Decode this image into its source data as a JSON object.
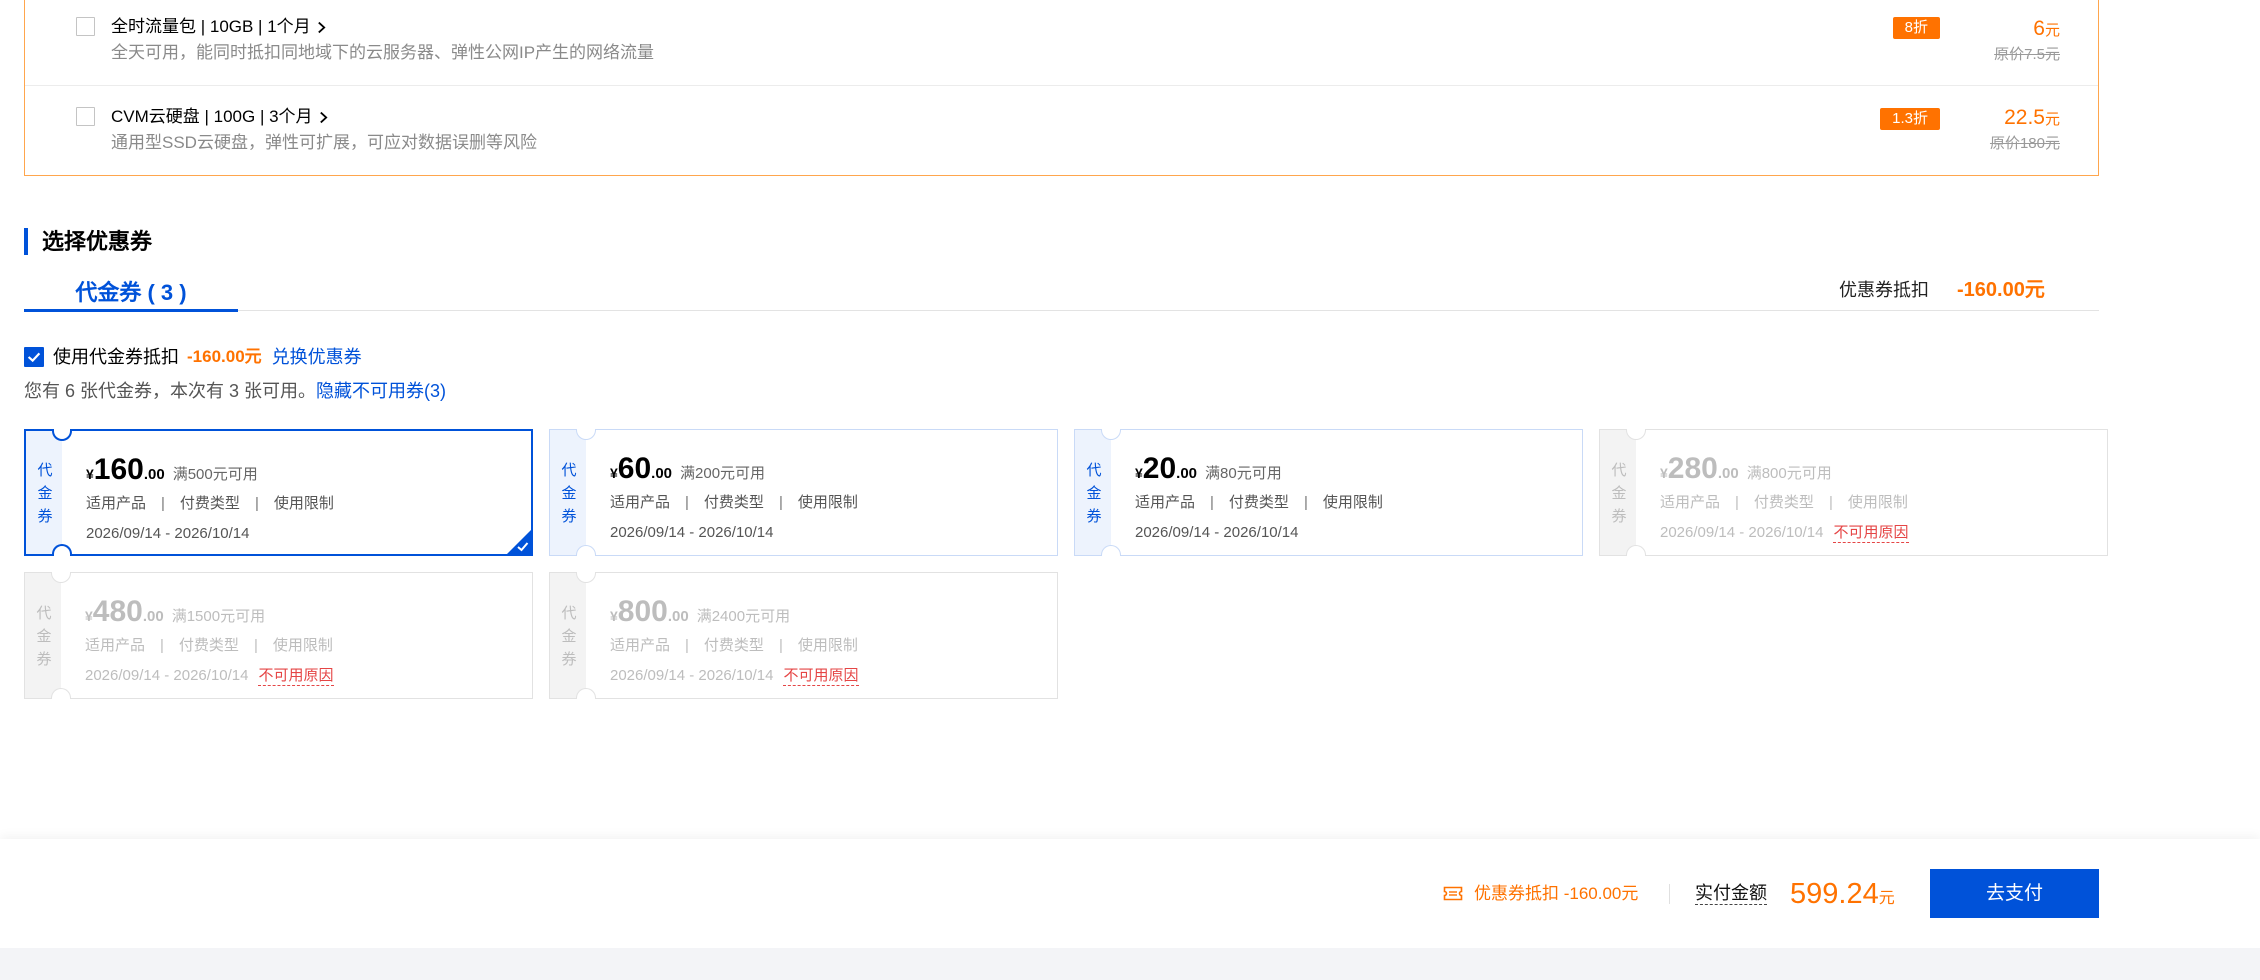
{
  "colors": {
    "accent_blue": "#0052d9",
    "price_orange": "#ff7200",
    "addon_border": "#ffa64d",
    "unavailable_red": "#e54545"
  },
  "icons": {
    "addon_title": "chevron-right-icon",
    "checkbox_checked": "check-icon",
    "footer_coupon": "ticket-icon",
    "selected_coupon": "corner-check-icon"
  },
  "addons": [
    {
      "title": "全时流量包 | 10GB | 1个月",
      "description": "全天可用，能同时抵扣同地域下的云服务器、弹性公网IP产生的网络流量",
      "discount": "8折",
      "price": "6",
      "price_unit": "元",
      "original_price": "原价7.5元",
      "checked": false
    },
    {
      "title": "CVM云硬盘 | 100G | 3个月",
      "description": "通用型SSD云硬盘，弹性可扩展，可应对数据误删等风险",
      "discount": "1.3折",
      "price": "22.5",
      "price_unit": "元",
      "original_price": "原价180元",
      "checked": false
    }
  ],
  "coupon_section": {
    "title": "选择优惠券",
    "tab_label": "代金券 ( 3 )",
    "deduct_label": "优惠券抵扣",
    "deduct_value": "-160.00元",
    "use_coupon_checked": true,
    "use_coupon_label": "使用代金券抵扣",
    "use_coupon_value": "-160.00元",
    "exchange_link": "兑换优惠券",
    "summary_text": "您有 6 张代金券，本次有 3 张可用。",
    "hide_unavailable_link": "隐藏不可用券(3)"
  },
  "tag_separator": "|",
  "coupons": [
    {
      "type_label": "代金券",
      "currency": "¥",
      "amount_int": "160",
      "amount_decimal": ".00",
      "threshold": "满500元可用",
      "tags": [
        "适用产品",
        "付费类型",
        "使用限制"
      ],
      "validity": "2026/09/14 - 2026/10/14",
      "state": "selected"
    },
    {
      "type_label": "代金券",
      "currency": "¥",
      "amount_int": "60",
      "amount_decimal": ".00",
      "threshold": "满200元可用",
      "tags": [
        "适用产品",
        "付费类型",
        "使用限制"
      ],
      "validity": "2026/09/14 - 2026/10/14",
      "state": "available"
    },
    {
      "type_label": "代金券",
      "currency": "¥",
      "amount_int": "20",
      "amount_decimal": ".00",
      "threshold": "满80元可用",
      "tags": [
        "适用产品",
        "付费类型",
        "使用限制"
      ],
      "validity": "2026/09/14 - 2026/10/14",
      "state": "available"
    },
    {
      "type_label": "代金券",
      "currency": "¥",
      "amount_int": "280",
      "amount_decimal": ".00",
      "threshold": "满800元可用",
      "tags": [
        "适用产品",
        "付费类型",
        "使用限制"
      ],
      "validity": "2026/09/14 - 2026/10/14",
      "state": "unavailable",
      "unavailable_reason": "不可用原因"
    },
    {
      "type_label": "代金券",
      "currency": "¥",
      "amount_int": "480",
      "amount_decimal": ".00",
      "threshold": "满1500元可用",
      "tags": [
        "适用产品",
        "付费类型",
        "使用限制"
      ],
      "validity": "2026/09/14 - 2026/10/14",
      "state": "unavailable",
      "unavailable_reason": "不可用原因"
    },
    {
      "type_label": "代金券",
      "currency": "¥",
      "amount_int": "800",
      "amount_decimal": ".00",
      "threshold": "满2400元可用",
      "tags": [
        "适用产品",
        "付费类型",
        "使用限制"
      ],
      "validity": "2026/09/14 - 2026/10/14",
      "state": "unavailable",
      "unavailable_reason": "不可用原因"
    }
  ],
  "footer": {
    "coupon_deduct": "优惠券抵扣 -160.00元",
    "payable_label": "实付金额",
    "payable_amount": "599.24",
    "payable_unit": "元",
    "pay_button": "去支付"
  }
}
